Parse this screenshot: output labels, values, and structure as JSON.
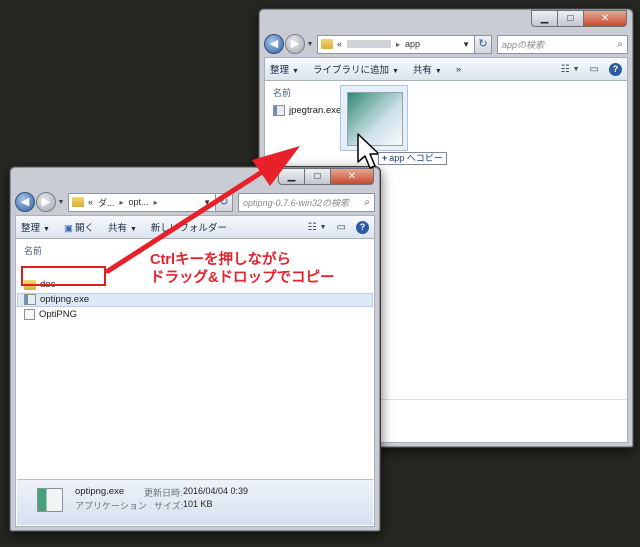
{
  "back_window": {
    "address": {
      "prefix": "«",
      "folder": "app"
    },
    "search_placeholder": "appの検索",
    "toolbar": {
      "organize": "整理",
      "add_to_library": "ライブラリに追加",
      "share": "共有",
      "more": "»"
    },
    "column_header": "名前",
    "files": [
      {
        "name": "jpegtran.exe"
      }
    ],
    "drop_tooltip": "app へコピー"
  },
  "front_window": {
    "address": {
      "prefix": "«",
      "crumb1": "ダ...",
      "crumb2": "opt..."
    },
    "search_placeholder": "optipng-0.7.6-win32の検索",
    "toolbar": {
      "organize": "整理",
      "open": "開く",
      "share": "共有",
      "new_folder": "新しいフォルダー"
    },
    "column_header": "名前",
    "files": [
      {
        "name": "doc"
      },
      {
        "name": "optipng.exe"
      },
      {
        "name": "OptiPNG"
      }
    ],
    "status": {
      "file_name": "optipng.exe",
      "modified_label": "更新日時:",
      "modified_value": "2016/04/04 0:39",
      "type": "アプリケーション",
      "size_label": "サイズ:",
      "size_value": "101 KB"
    }
  },
  "annotation": {
    "line1": "Ctrlキーを押しながら",
    "line2": "ドラッグ&ドロップでコピー"
  },
  "colors": {
    "annotation_red": "#e8202a",
    "selection": "#dce9f7"
  }
}
